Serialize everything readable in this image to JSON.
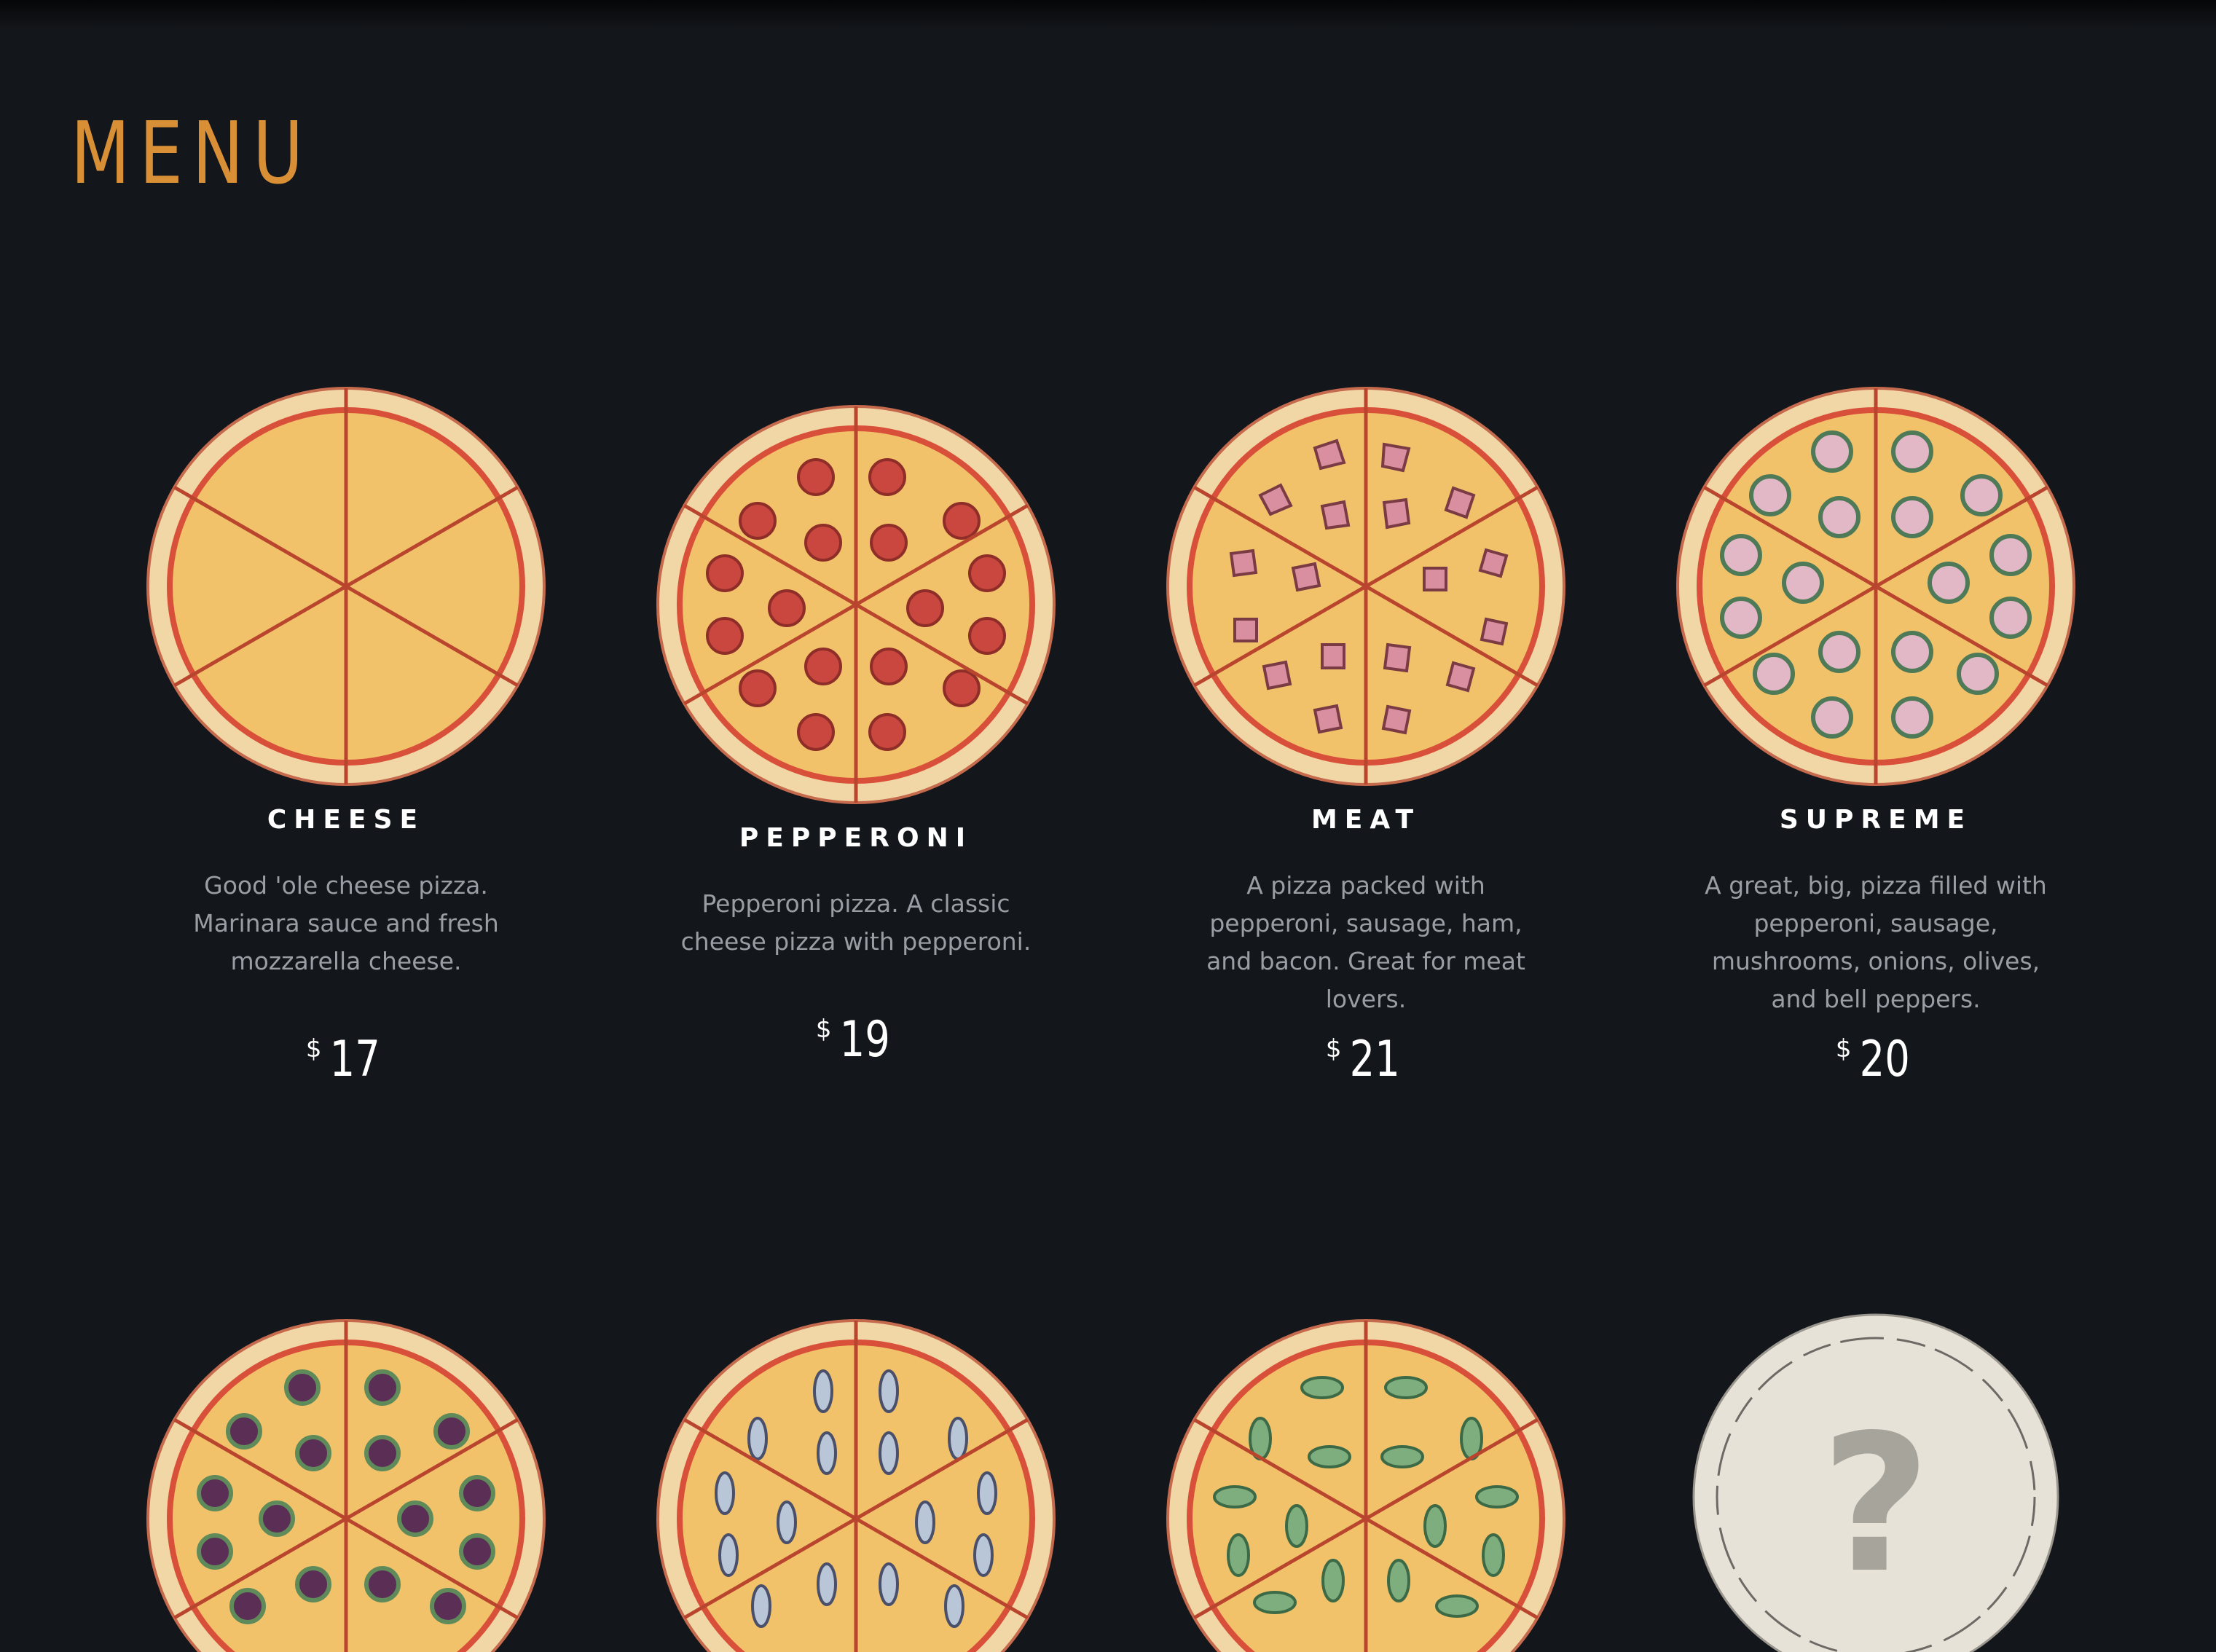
{
  "page": {
    "title": "MENU",
    "accent_color": "#d88f36",
    "background_color": "#13161a"
  },
  "menu": {
    "items": [
      {
        "name": "CHEESE",
        "description": "Good 'ole cheese pizza. Marinara sauce and fresh mozzarella cheese.",
        "currency": "$",
        "price": "17",
        "topping": "none"
      },
      {
        "name": "PEPPERONI",
        "description": "Pepperoni pizza. A classic cheese pizza with pepperoni.",
        "currency": "$",
        "price": "19",
        "topping": "pepperoni"
      },
      {
        "name": "MEAT",
        "description": "A pizza packed with pepperoni, sausage, ham, and bacon. Great for meat lovers.",
        "currency": "$",
        "price": "21",
        "topping": "meat"
      },
      {
        "name": "SUPREME",
        "description": "A great, big, pizza filled with pepperoni, sausage, mushrooms, onions, olives, and bell peppers.",
        "currency": "$",
        "price": "20",
        "topping": "supreme"
      }
    ],
    "row2_items": [
      {
        "icon": "pizza-veggie-icon",
        "topping": "veggie"
      },
      {
        "icon": "pizza-anchovy-icon",
        "topping": "anchovy"
      },
      {
        "icon": "pizza-basil-icon",
        "topping": "basil"
      },
      {
        "icon": "mystery-pizza-question-icon",
        "symbol": "?"
      }
    ]
  }
}
